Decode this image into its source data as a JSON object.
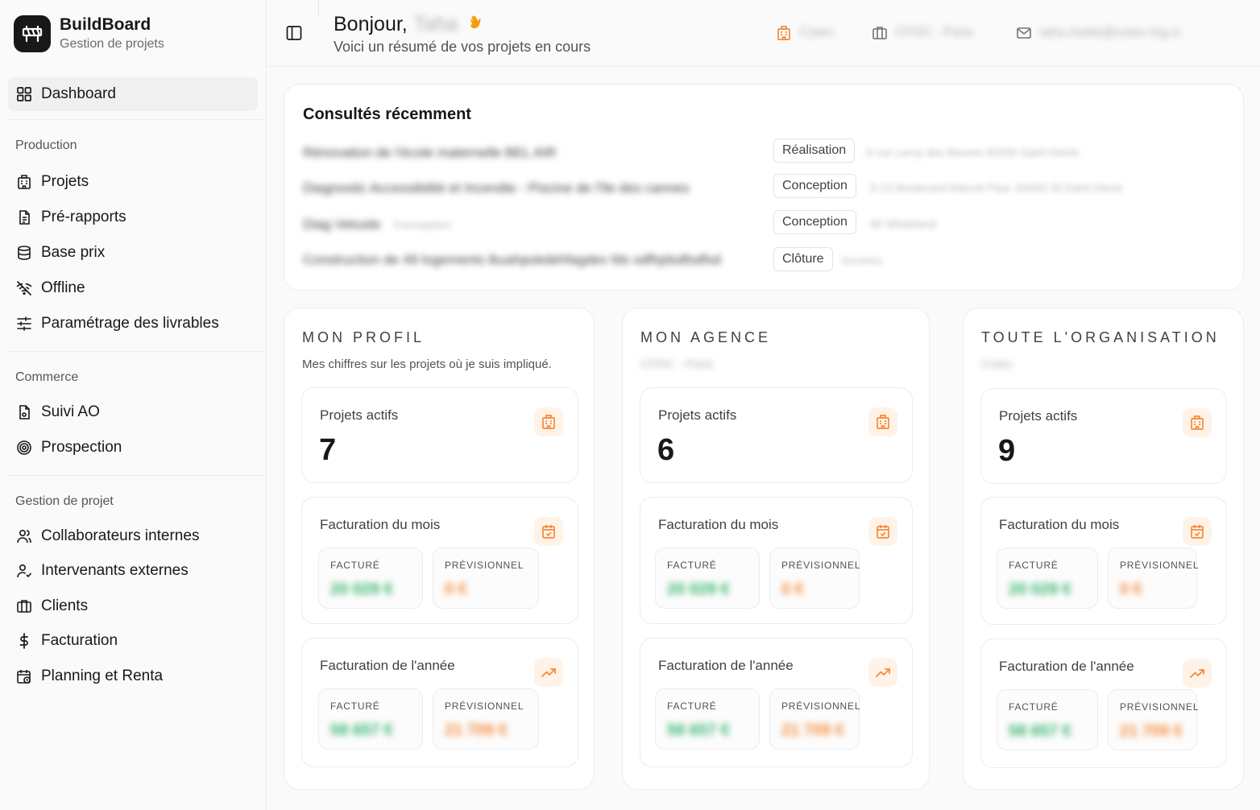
{
  "brand": {
    "title": "BuildBoard",
    "subtitle": "Gestion de projets"
  },
  "sidebar": {
    "dashboard": "Dashboard",
    "sections": [
      {
        "label": "Production",
        "items": [
          "Projets",
          "Pré-rapports",
          "Base prix",
          "Offline",
          "Paramétrage des livrables"
        ]
      },
      {
        "label": "Commerce",
        "items": [
          "Suivi AO",
          "Prospection"
        ]
      },
      {
        "label": "Gestion de projet",
        "items": [
          "Collaborateurs internes",
          "Intervenants externes",
          "Clients",
          "Facturation",
          "Planning et Renta"
        ]
      }
    ]
  },
  "header": {
    "greeting": "Bonjour,",
    "user_name": "Taha",
    "subtitle": "Voici un résumé de vos projets en cours",
    "company": "Cotec",
    "agency": "CPDC - Paris",
    "email": "taha.mekki@cotec-ing.ci"
  },
  "recent": {
    "title": "Consultés récemment",
    "rows": [
      {
        "name": "Rénovation de l'école maternelle BEL AIR",
        "badge": "Réalisation",
        "address": "8 rue Leroy des Bevres 93200 Saint-Denis"
      },
      {
        "name": "Diagnostic Accessibilité et Incendie - Piscine de l'île des cannes",
        "badge": "Conception",
        "address": "9-13 Boulevard Marcel Paul, 93400 St-Saint-Denis"
      },
      {
        "name": "Diag Vetuste",
        "name_suffix": "Conception",
        "badge": "Conception",
        "address": "60 Whiteland"
      },
      {
        "name": "Construction de 49 logements lkuahpokdehfagdev fds sdfhjdsdfsdfsd",
        "badge": "Clôture",
        "address": "Inconnu"
      }
    ]
  },
  "columns": [
    {
      "title": "MON PROFIL",
      "subtitle": "Mes chiffres sur les projets où je suis impliqué.",
      "subtitle_blur": false,
      "active_label": "Projets actifs",
      "active_value": "7",
      "month_label": "Facturation du mois",
      "month_facture": "20 029 €",
      "month_prev": "0 €",
      "year_label": "Facturation de l'année",
      "year_facture": "58 657 €",
      "year_prev": "21 709 €"
    },
    {
      "title": "MON AGENCE",
      "subtitle": "CPDC - Paris",
      "subtitle_blur": true,
      "active_label": "Projets actifs",
      "active_value": "6",
      "month_label": "Facturation du mois",
      "month_facture": "20 029 €",
      "month_prev": "0 €",
      "year_label": "Facturation de l'année",
      "year_facture": "58 657 €",
      "year_prev": "21 709 €"
    },
    {
      "title": "TOUTE L'ORGANISATION",
      "subtitle": "Cotec",
      "subtitle_blur": true,
      "active_label": "Projets actifs",
      "active_value": "9",
      "month_label": "Facturation du mois",
      "month_facture": "20 029 €",
      "month_prev": "0 €",
      "year_label": "Facturation de l'année",
      "year_facture": "58 657 €",
      "year_prev": "21 709 €"
    }
  ],
  "labels": {
    "facture": "FACTURÉ",
    "previsionnel": "PRÉVISIONNEL"
  },
  "colors": {
    "accent": "#f58a3a",
    "green": "#34b46c",
    "accent_bg": "#fff3e8"
  }
}
